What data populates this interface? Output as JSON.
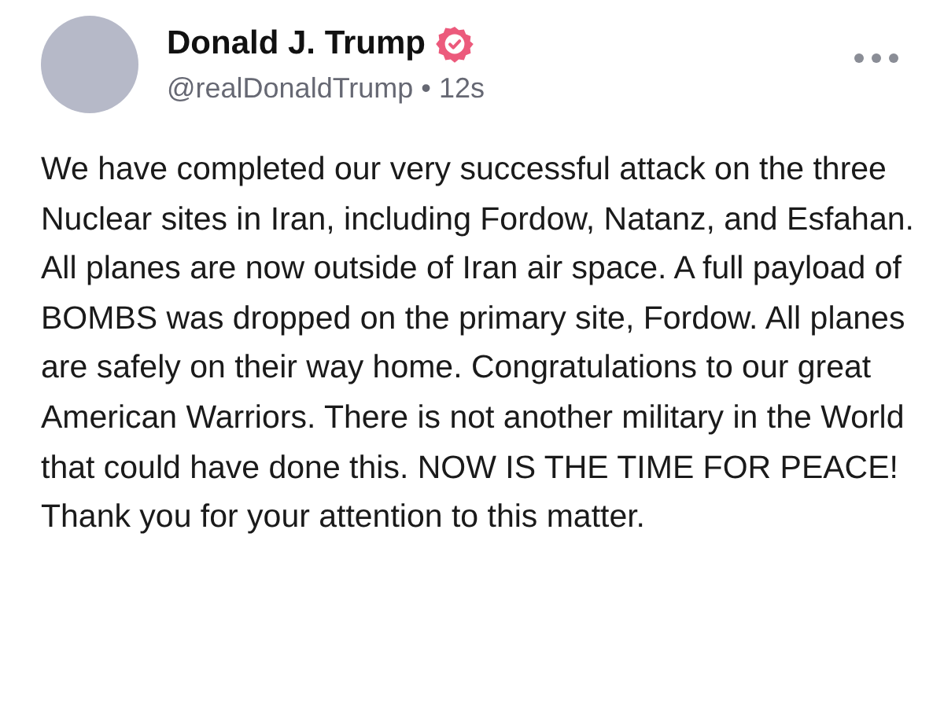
{
  "post": {
    "author": "Donald J. Trump",
    "verified": true,
    "handle": "@realDonaldTrump",
    "separator": "•",
    "time": "12s",
    "text": "We have completed our very successful attack on the three Nuclear sites in Iran, including Fordow, Natanz, and Esfahan. All planes are now outside of Iran air space. A full payload of BOMBS was dropped on the primary site, Fordow. All planes are safely on their way home. Congratulations to our great American Warriors. There is not another military in the World that could have done this. NOW IS THE TIME FOR PEACE! Thank you for your attention to this matter."
  }
}
